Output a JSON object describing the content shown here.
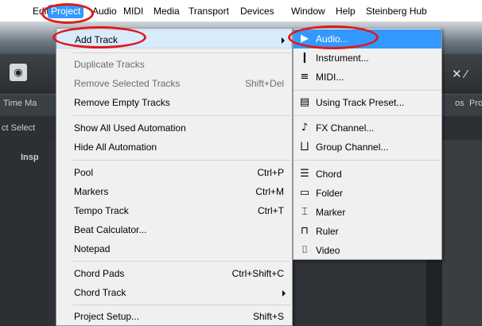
{
  "menubar": {
    "items": [
      "Edit",
      "Project",
      "Audio",
      "MIDI",
      "Media",
      "Transport",
      "Devices",
      "Window",
      "Help",
      "Steinberg Hub"
    ]
  },
  "background": {
    "time_label": "Time Ma",
    "select_label": "ct Select",
    "inspector_label": "Insp",
    "right_label1": "os",
    "right_label2": "Pro",
    "icon_left": "◉",
    "icon_right": "✕ ⁄"
  },
  "project_menu": {
    "items": [
      {
        "label": "Add Track",
        "shortcut": "",
        "submenu": true,
        "disabled": false
      },
      {
        "label": "Duplicate Tracks",
        "shortcut": "",
        "disabled": true
      },
      {
        "label": "Remove Selected Tracks",
        "shortcut": "Shift+Del",
        "disabled": true
      },
      {
        "label": "Remove Empty Tracks",
        "shortcut": "",
        "disabled": false
      },
      {
        "label": "Show All Used Automation",
        "shortcut": "",
        "disabled": false
      },
      {
        "label": "Hide All Automation",
        "shortcut": "",
        "disabled": false
      },
      {
        "label": "Pool",
        "shortcut": "Ctrl+P",
        "disabled": false
      },
      {
        "label": "Markers",
        "shortcut": "Ctrl+M",
        "disabled": false
      },
      {
        "label": "Tempo Track",
        "shortcut": "Ctrl+T",
        "disabled": false
      },
      {
        "label": "Beat Calculator...",
        "shortcut": "",
        "disabled": false
      },
      {
        "label": "Notepad",
        "shortcut": "",
        "disabled": false
      },
      {
        "label": "Chord Pads",
        "shortcut": "Ctrl+Shift+C",
        "disabled": false
      },
      {
        "label": "Chord Track",
        "shortcut": "",
        "submenu": true,
        "disabled": false
      },
      {
        "label": "Project Setup...",
        "shortcut": "Shift+S",
        "disabled": false
      }
    ]
  },
  "add_track_submenu": {
    "items": [
      {
        "label": "Audio...",
        "icon": "▶",
        "icon_name": "audio-track-icon"
      },
      {
        "label": "Instrument...",
        "icon": "❙",
        "icon_name": "instrument-track-icon"
      },
      {
        "label": "MIDI...",
        "icon": "≡",
        "icon_name": "midi-track-icon"
      },
      {
        "label": "Using Track Preset...",
        "icon": "▤",
        "icon_name": "track-preset-icon"
      },
      {
        "label": "FX Channel...",
        "icon": "♪",
        "icon_name": "fx-channel-icon"
      },
      {
        "label": "Group Channel...",
        "icon": "⨆",
        "icon_name": "group-channel-icon"
      },
      {
        "label": "Chord",
        "icon": "☰",
        "icon_name": "chord-track-icon"
      },
      {
        "label": "Folder",
        "icon": "▭",
        "icon_name": "folder-track-icon"
      },
      {
        "label": "Marker",
        "icon": "⌶",
        "icon_name": "marker-track-icon"
      },
      {
        "label": "Ruler",
        "icon": "⊓",
        "icon_name": "ruler-track-icon"
      },
      {
        "label": "Video",
        "icon": "⌷",
        "icon_name": "video-track-icon"
      }
    ]
  },
  "colors": {
    "menu_highlight": "#3399ff",
    "annotation_red": "#e0191b",
    "menu_bg": "#f0f0f0"
  }
}
